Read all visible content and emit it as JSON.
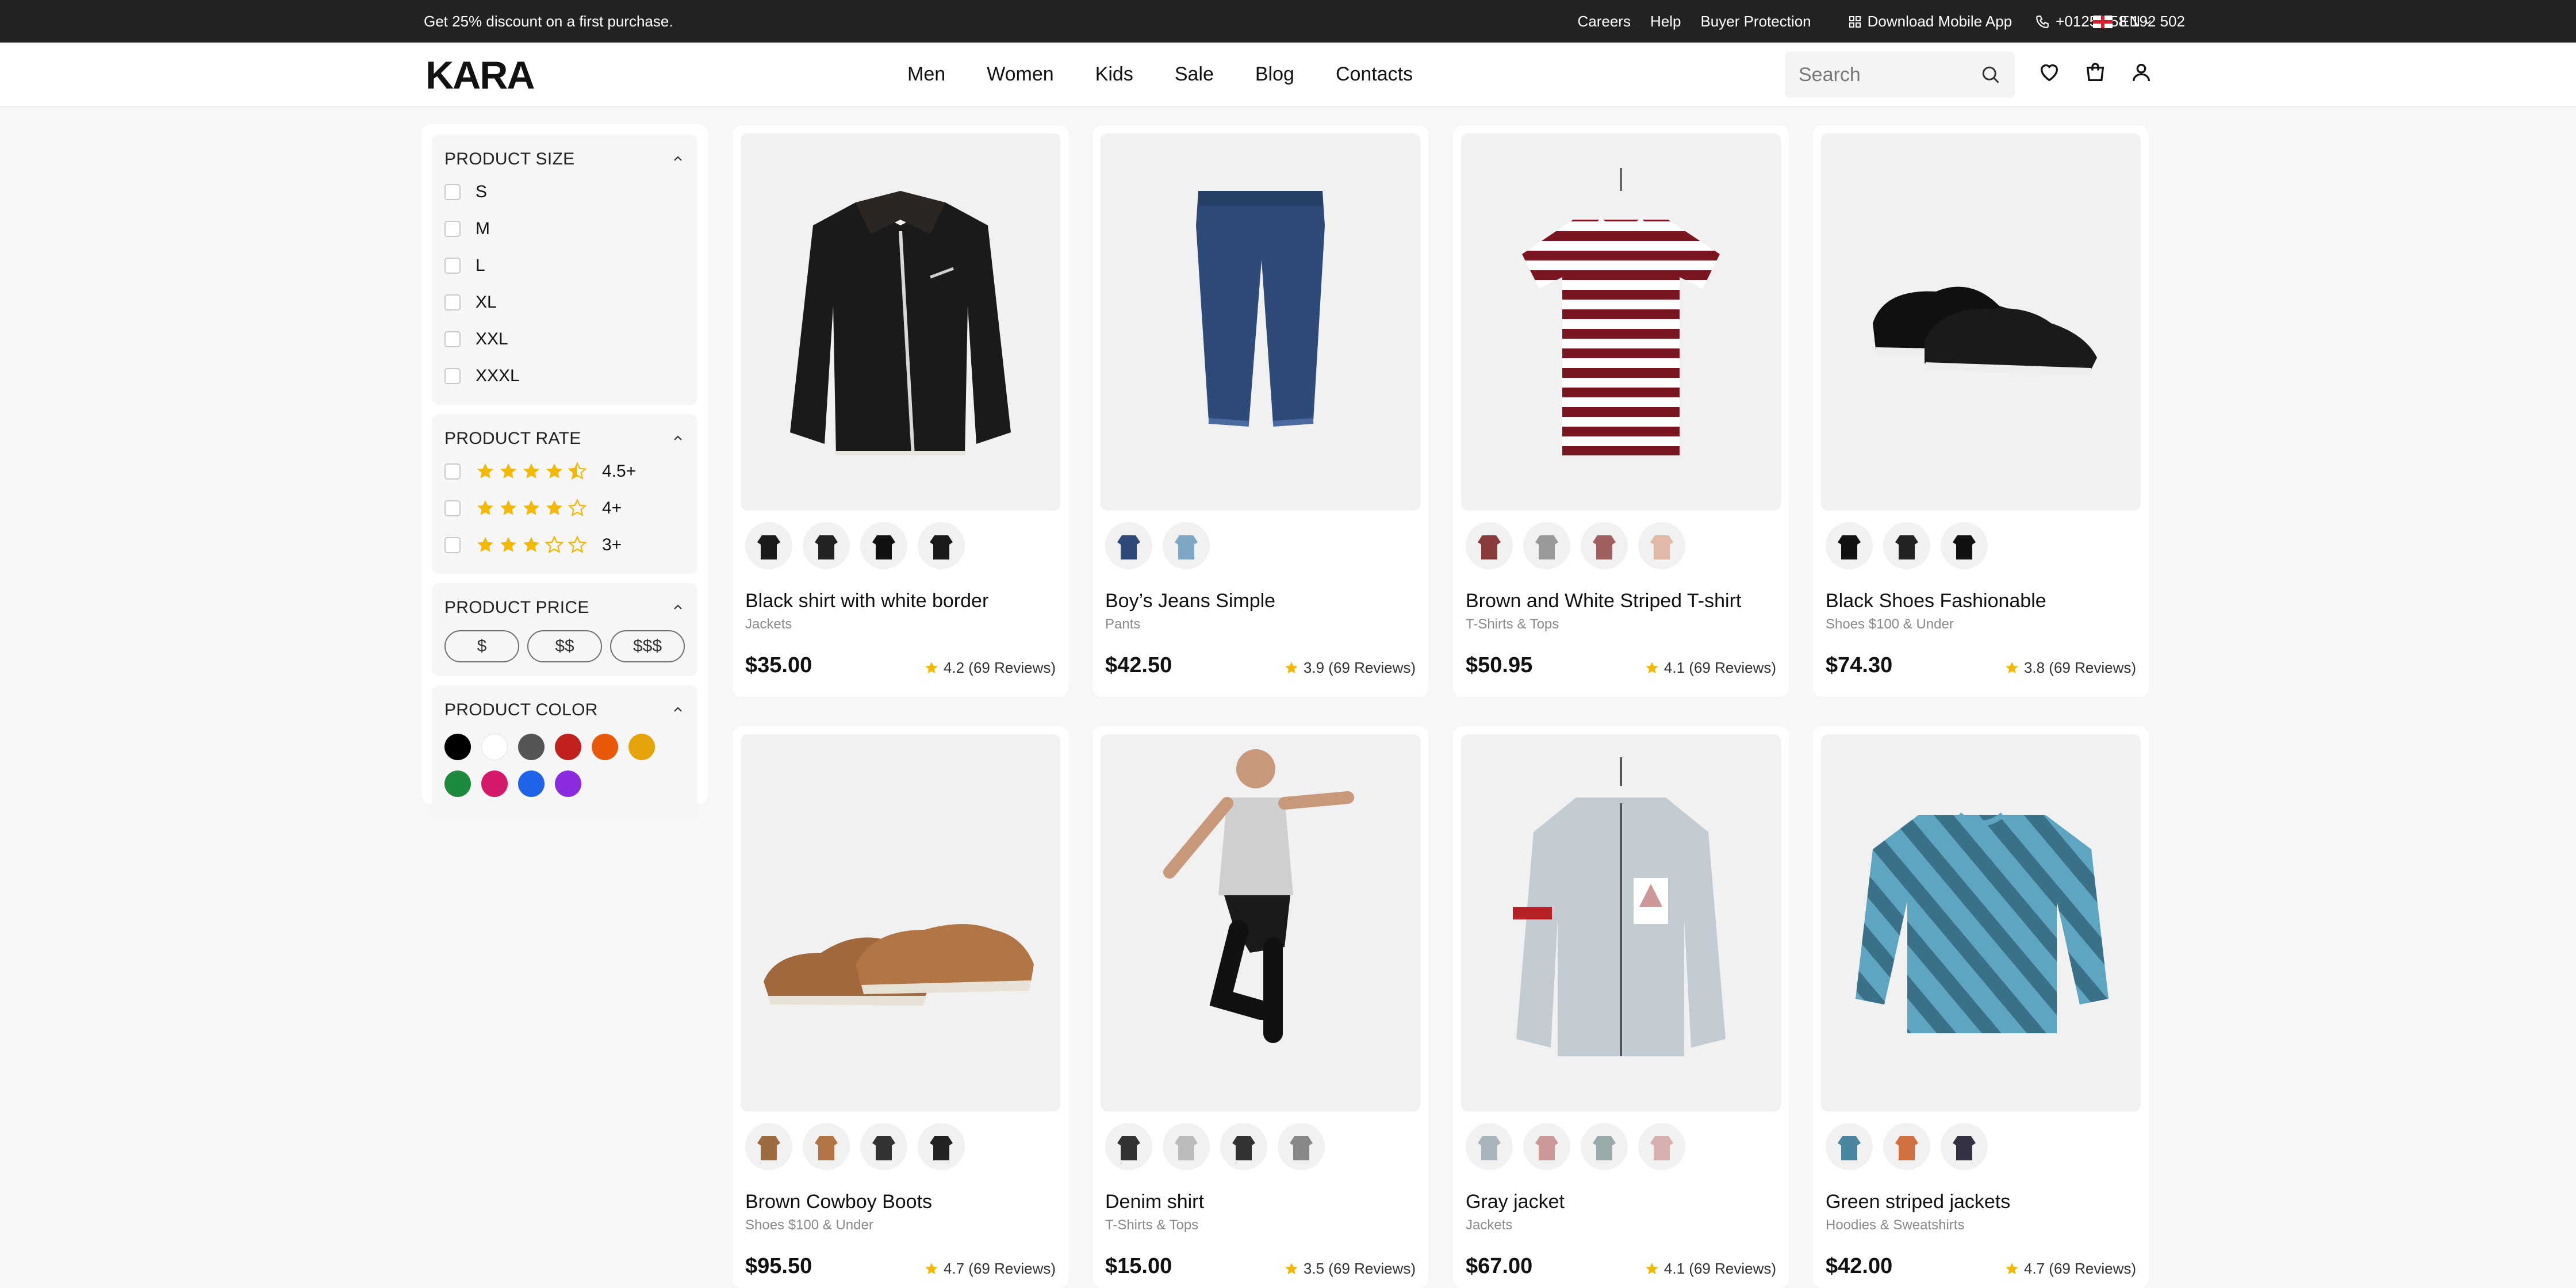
{
  "topbar": {
    "promo": "Get 25% discount on a first purchase.",
    "links": [
      "Careers",
      "Help",
      "Buyer Protection"
    ],
    "app": "Download Mobile App",
    "phone": "+0125 258 192 502",
    "lang": "EN"
  },
  "header": {
    "logo": "KARA",
    "nav": [
      "Men",
      "Women",
      "Kids",
      "Sale",
      "Blog",
      "Contacts"
    ],
    "search_placeholder": "Search"
  },
  "filters": {
    "size": {
      "title": "PRODUCT SIZE",
      "options": [
        "S",
        "M",
        "L",
        "XL",
        "XXL",
        "XXXL"
      ]
    },
    "rate": {
      "title": "PRODUCT RATE",
      "options": [
        {
          "label": "4.5+",
          "stars": 4.5
        },
        {
          "label": "4+",
          "stars": 4
        },
        {
          "label": "3+",
          "stars": 3
        }
      ]
    },
    "price": {
      "title": "PRODUCT PRICE",
      "options": [
        "$",
        "$$",
        "$$$"
      ]
    },
    "color": {
      "title": "PRODUCT COLOR",
      "swatches": [
        "#000000",
        "#ffffff",
        "#555555",
        "#c0211f",
        "#e8590c",
        "#e5a50a",
        "#1e8a3e",
        "#d6186a",
        "#1f63e8",
        "#8a2be2"
      ]
    }
  },
  "products": [
    {
      "title": "Black shirt with white border",
      "category": "Jackets",
      "price": "$35.00",
      "rating": "4.2 (69 Reviews)",
      "image": "leather-jacket",
      "thumbs": 4
    },
    {
      "title": "Boy’s Jeans Simple",
      "category": "Pants",
      "price": "$42.50",
      "rating": "3.9 (69 Reviews)",
      "image": "jeans",
      "thumbs": 2
    },
    {
      "title": "Brown and White Striped T-shirt",
      "category": "T-Shirts & Tops",
      "price": "$50.95",
      "rating": "4.1 (69 Reviews)",
      "image": "striped-tshirt",
      "thumbs": 4
    },
    {
      "title": "Black Shoes Fashionable",
      "category": "Shoes $100 & Under",
      "price": "$74.30",
      "rating": "3.8 (69 Reviews)",
      "image": "black-shoes",
      "thumbs": 3
    },
    {
      "title": "Brown Cowboy Boots",
      "category": "Shoes $100 & Under",
      "price": "$95.50",
      "rating": "4.7 (69 Reviews)",
      "image": "brown-shoes",
      "thumbs": 4
    },
    {
      "title": "Denim shirt",
      "category": "T-Shirts & Tops",
      "price": "$15.00",
      "rating": "3.5 (69 Reviews)",
      "image": "jumping-man",
      "thumbs": 4
    },
    {
      "title": "Gray jacket",
      "category": "Jackets",
      "price": "$67.00",
      "rating": "4.1 (69 Reviews)",
      "image": "bomber-jacket",
      "thumbs": 4
    },
    {
      "title": "Green striped jackets",
      "category": "Hoodies & Sweatshirts",
      "price": "$42.00",
      "rating": "4.7 (69 Reviews)",
      "image": "striped-sweater",
      "thumbs": 3
    }
  ]
}
